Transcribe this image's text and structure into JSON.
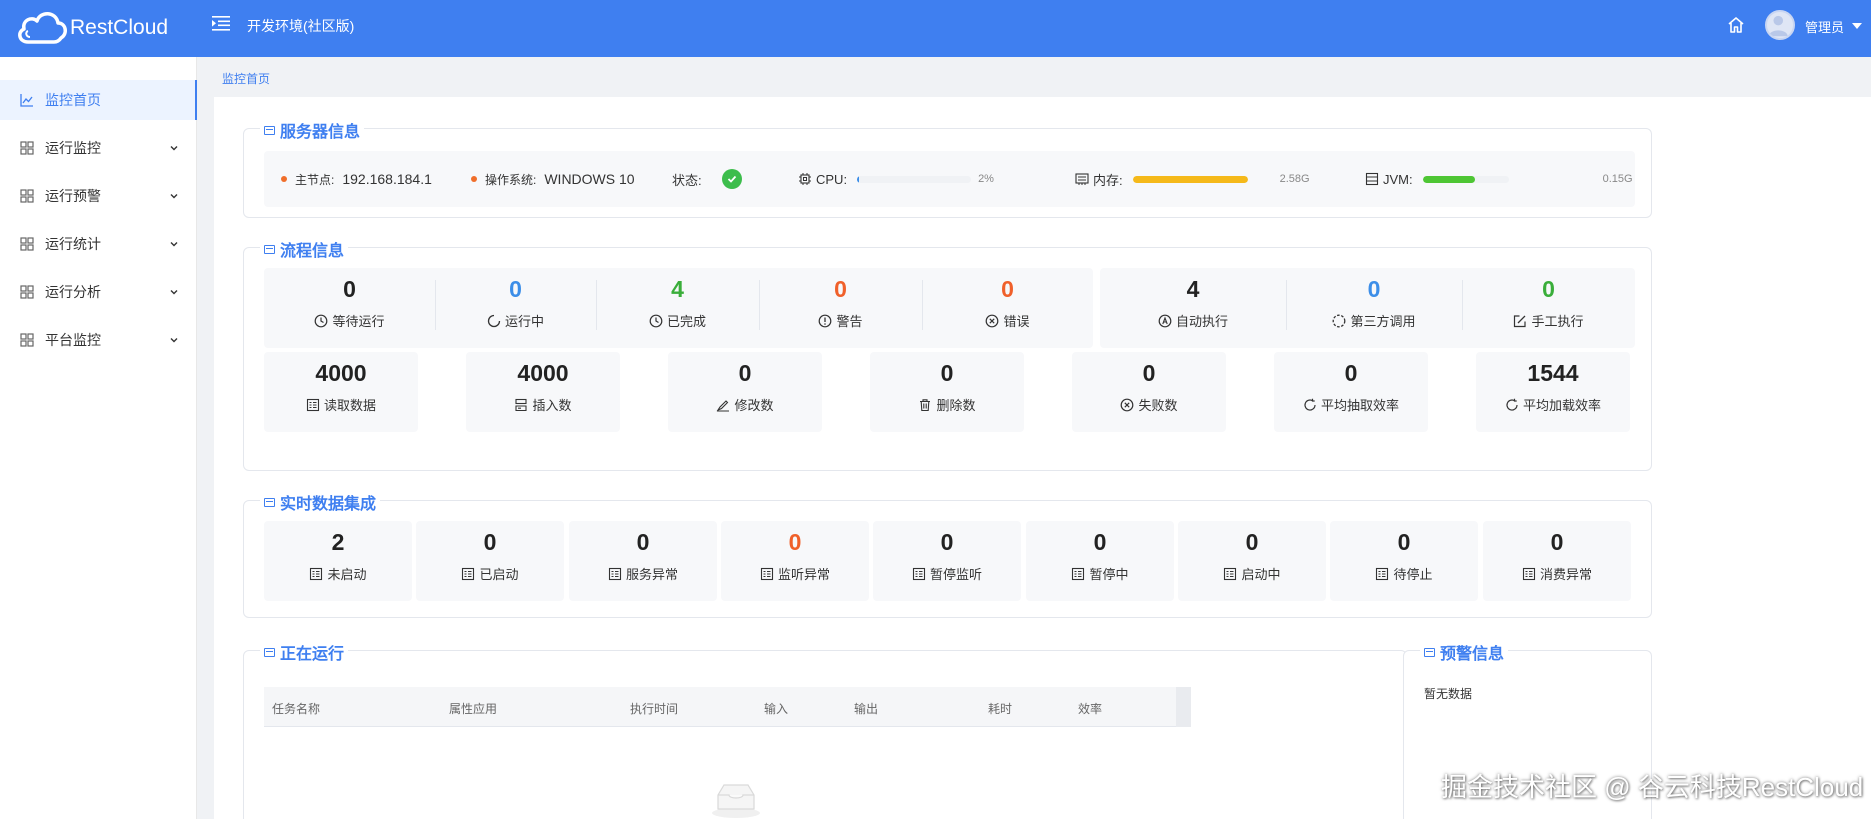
{
  "app": {
    "logo_text": "RestCloud",
    "env_title": "开发环境(社区版)",
    "user_name": "管理员"
  },
  "colors": {
    "brand": "#3f7ff0",
    "ok": "#3dbd4c",
    "warn": "#f0602a",
    "mem_bar": "#f5b91a",
    "jvm_bar": "#4ec634"
  },
  "sidebar": {
    "items": [
      {
        "label": "监控首页",
        "icon": "chart-icon"
      },
      {
        "label": "运行监控",
        "icon": "grid-icon"
      },
      {
        "label": "运行预警",
        "icon": "grid-icon"
      },
      {
        "label": "运行统计",
        "icon": "grid-icon"
      },
      {
        "label": "运行分析",
        "icon": "grid-icon"
      },
      {
        "label": "平台监控",
        "icon": "grid-icon"
      }
    ]
  },
  "breadcrumb": "监控首页",
  "server": {
    "title": "服务器信息",
    "master_label": "主节点:",
    "master_value": "192.168.184.1",
    "os_label": "操作系统:",
    "os_value": "WINDOWS 10",
    "status_label": "状态:",
    "cpu_label": "CPU:",
    "cpu_value": "2%",
    "cpu_level": 0.02,
    "mem_label": "内存:",
    "mem_value": "2.58G",
    "mem_level": 1.0,
    "jvm_label": "JVM:",
    "jvm_value": "0.15G",
    "jvm_level": 0.6
  },
  "flow": {
    "title": "流程信息",
    "status": [
      {
        "value": "0",
        "label": "等待运行",
        "icon": "clock-icon"
      },
      {
        "value": "0",
        "label": "运行中",
        "icon": "loading-icon"
      },
      {
        "value": "4",
        "label": "已完成",
        "icon": "clock-icon"
      },
      {
        "value": "0",
        "label": "警告",
        "icon": "warning-icon"
      },
      {
        "value": "0",
        "label": "错误",
        "icon": "error-icon"
      }
    ],
    "modes": [
      {
        "value": "4",
        "label": "自动执行",
        "icon": "auto-icon"
      },
      {
        "value": "0",
        "label": "第三方调用",
        "icon": "dashed-circle-icon"
      },
      {
        "value": "0",
        "label": "手工执行",
        "icon": "edit-icon"
      }
    ],
    "data": [
      {
        "value": "4000",
        "label": "读取数据",
        "icon": "read-icon"
      },
      {
        "value": "4000",
        "label": "插入数",
        "icon": "insert-icon"
      },
      {
        "value": "0",
        "label": "修改数",
        "icon": "modify-icon"
      },
      {
        "value": "0",
        "label": "删除数",
        "icon": "trash-icon"
      },
      {
        "value": "0",
        "label": "失败数",
        "icon": "fail-icon"
      },
      {
        "value": "0",
        "label": "平均抽取效率",
        "icon": "refresh-icon"
      },
      {
        "value": "1544",
        "label": "平均加载效率",
        "icon": "refresh-icon"
      }
    ]
  },
  "realtime": {
    "title": "实时数据集成",
    "items": [
      {
        "value": "2",
        "label": "未启动"
      },
      {
        "value": "0",
        "label": "已启动"
      },
      {
        "value": "0",
        "label": "服务异常"
      },
      {
        "value": "0",
        "label": "监听异常"
      },
      {
        "value": "0",
        "label": "暂停监听"
      },
      {
        "value": "0",
        "label": "暂停中"
      },
      {
        "value": "0",
        "label": "启动中"
      },
      {
        "value": "0",
        "label": "待停止"
      },
      {
        "value": "0",
        "label": "消费异常"
      }
    ]
  },
  "running": {
    "title": "正在运行",
    "columns": [
      "任务名称",
      "属性应用",
      "执行时间",
      "输入",
      "输出",
      "耗时",
      "效率"
    ]
  },
  "alerts": {
    "title": "预警信息",
    "empty_text": "暂无数据"
  },
  "watermark": "掘金技术社区 @ 谷云科技RestCloud"
}
